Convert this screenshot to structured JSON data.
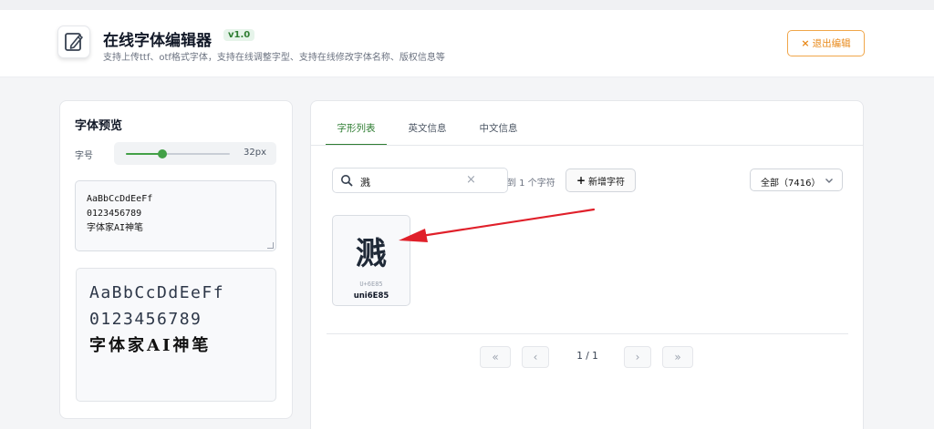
{
  "header": {
    "title": "在线字体编辑器",
    "version": "v1.0",
    "subtitle": "支持上传ttf、otf格式字体，支持在线调整字型、支持在线修改字体名称、版权信息等",
    "exit_label": "退出编辑",
    "exit_icon": "×"
  },
  "preview_panel": {
    "title": "字体预览",
    "size_label": "字号",
    "size_value": "32px",
    "size_fraction": 0.35,
    "sample_text": "AaBbCcDdEeFf\n0123456789\n字体家AI神笔",
    "preview_lines": [
      "AaBbCcDdEeFf",
      "0123456789",
      "字体家AI神笔"
    ]
  },
  "tabs": [
    {
      "label": "字形列表",
      "active": true
    },
    {
      "label": "英文信息",
      "active": false
    },
    {
      "label": "中文信息",
      "active": false
    }
  ],
  "toolbar": {
    "search_value": "溅",
    "found_text": "到 1 个字符",
    "add_label": "新增字符",
    "filter_value": "全部（7416）"
  },
  "glyphs": [
    {
      "char": "溅",
      "code": "U+6E85",
      "name": "uni6E85"
    }
  ],
  "pagination": {
    "first": "«",
    "prev": "‹",
    "info": "1 / 1",
    "next": "›",
    "last": "»"
  },
  "colors": {
    "accent": "#2e7d32",
    "warn": "#e8891a",
    "annotation_arrow": "#e0202a"
  }
}
